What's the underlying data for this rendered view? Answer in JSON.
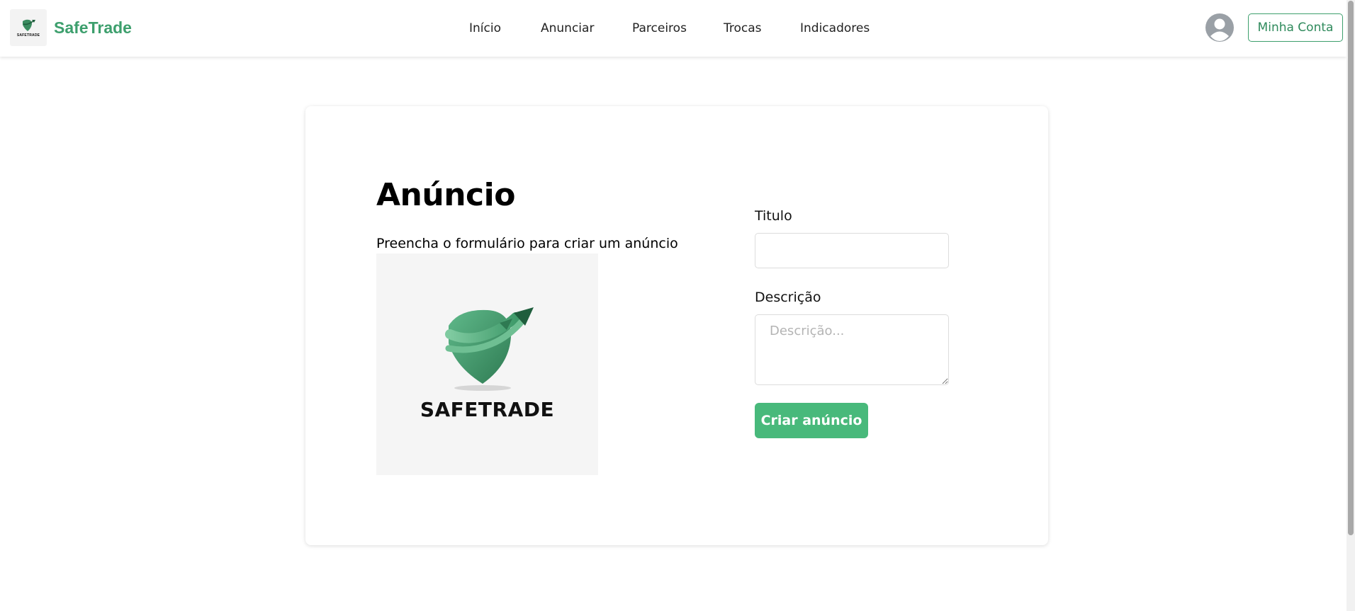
{
  "header": {
    "brand_name": "SafeTrade",
    "brand_logo_text": "SAFETRADE",
    "nav": [
      {
        "label": "Início"
      },
      {
        "label": "Anunciar"
      },
      {
        "label": "Parceiros"
      },
      {
        "label": "Trocas"
      },
      {
        "label": "Indicadores"
      }
    ],
    "account_button": "Minha Conta"
  },
  "main": {
    "title": "Anúncio",
    "subtitle": "Preencha o formulário para criar um anúncio",
    "image_text": "SAFETRADE"
  },
  "form": {
    "title_label": "Titulo",
    "title_value": "",
    "title_placeholder": "",
    "description_label": "Descrição",
    "description_value": "",
    "description_placeholder": "Descrição...",
    "submit_label": "Criar anúncio"
  },
  "colors": {
    "brand": "#3d9f6d",
    "button": "#48b97b"
  }
}
